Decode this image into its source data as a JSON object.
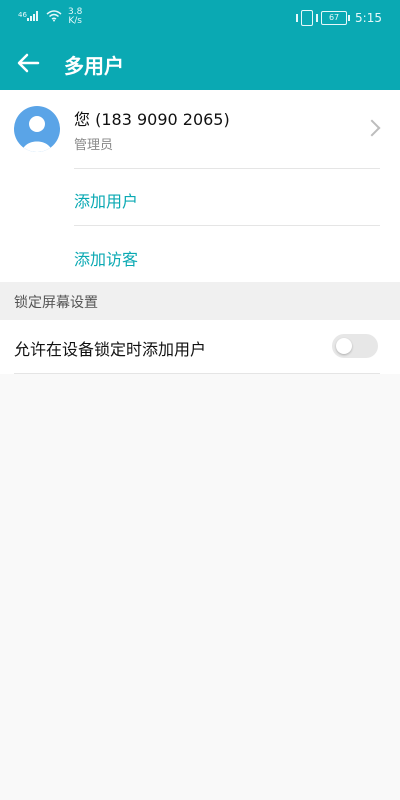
{
  "status_bar": {
    "network_speed_value": "3.8",
    "network_speed_unit": "K/s",
    "time": "5:15",
    "battery_level": "67"
  },
  "app_bar": {
    "title": "多用户"
  },
  "current_user": {
    "name": "您 (183 9090 2065)",
    "role": "管理员"
  },
  "actions": {
    "add_user": "添加用户",
    "add_guest": "添加访客"
  },
  "lock_screen": {
    "section_title": "锁定屏幕设置",
    "allow_add_users_label": "允许在设备锁定时添加用户",
    "allow_add_users_enabled": false
  }
}
